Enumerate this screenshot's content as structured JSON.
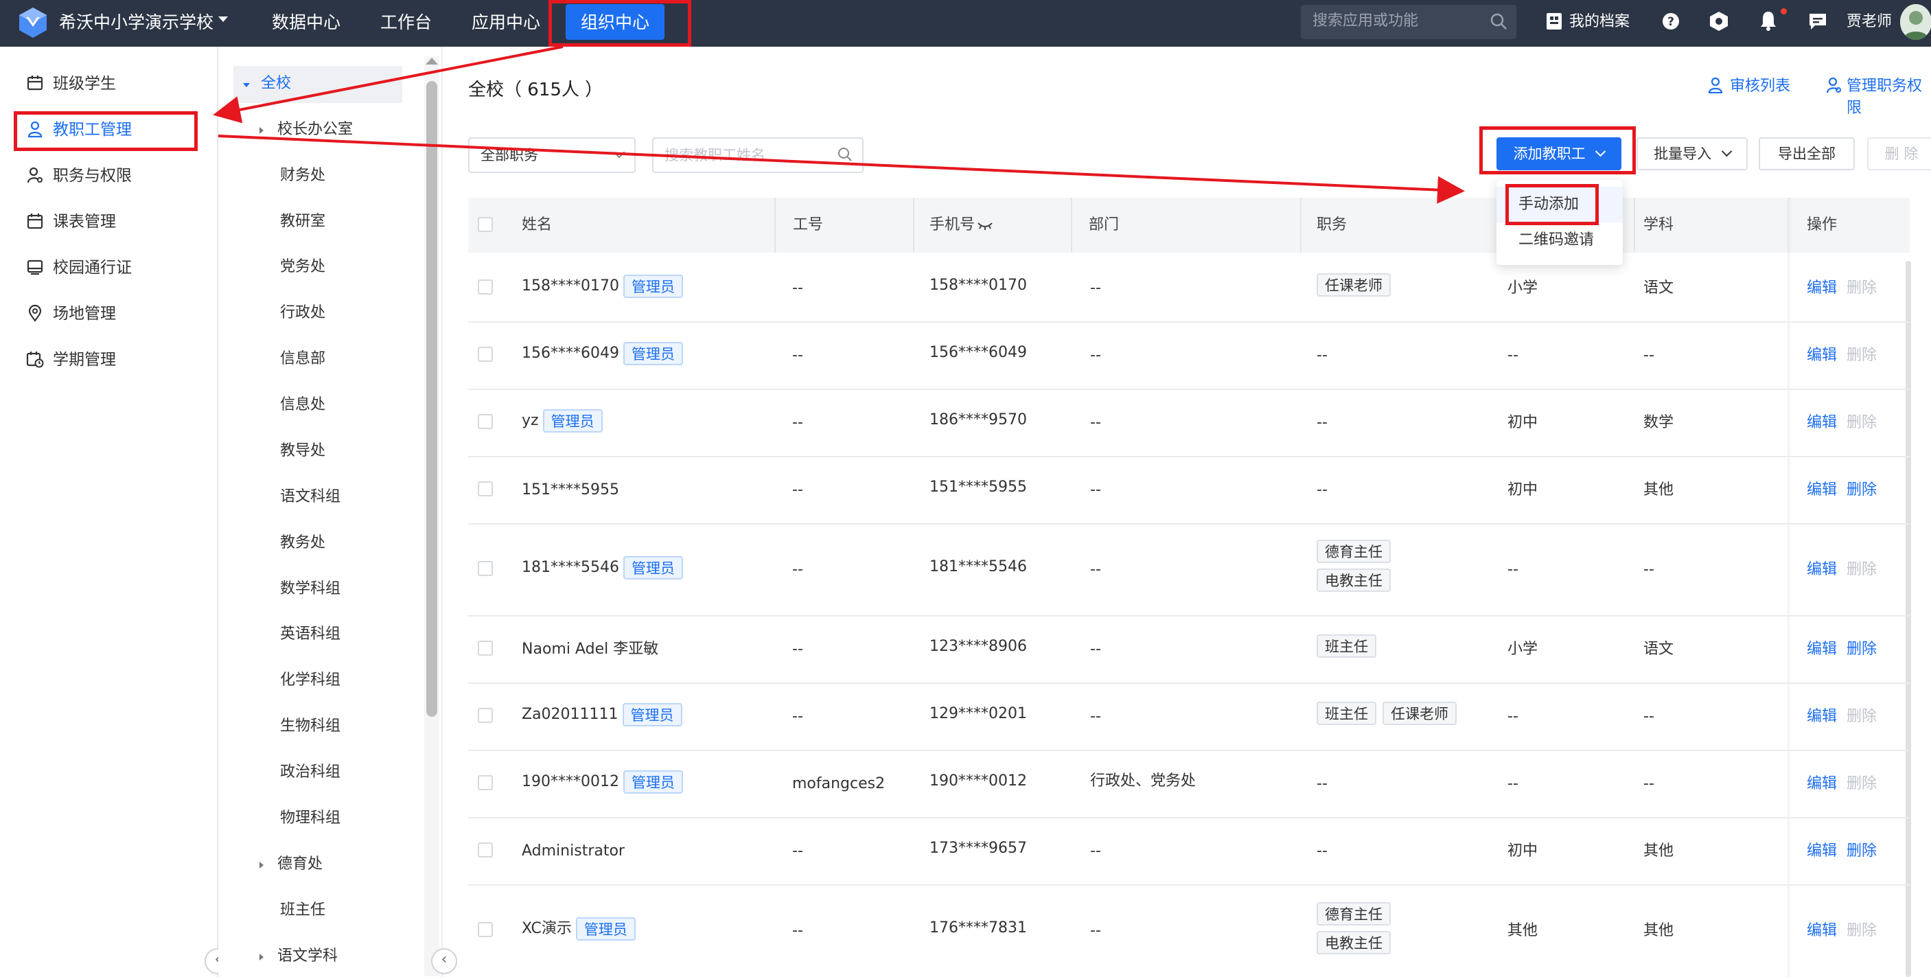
{
  "app": {
    "school_name": "希沃中小学演示学校",
    "nav": [
      "数据中心",
      "工作台",
      "应用中心",
      "组织中心"
    ],
    "search_placeholder": "搜索应用或功能",
    "my_profile": "我的档案",
    "user_name": "贾老师",
    "colors": {
      "topbar": "#2c3545",
      "accent": "#1d6ff2",
      "annotation": "#e5171f"
    }
  },
  "sidebar": {
    "items": [
      {
        "label": "班级学生",
        "icon": "class-icon"
      },
      {
        "label": "教职工管理",
        "icon": "user-icon"
      },
      {
        "label": "职务与权限",
        "icon": "user-key-icon"
      },
      {
        "label": "课表管理",
        "icon": "calendar-icon"
      },
      {
        "label": "校园通行证",
        "icon": "pass-card-icon"
      },
      {
        "label": "场地管理",
        "icon": "location-icon"
      },
      {
        "label": "学期管理",
        "icon": "calendar-clock-icon"
      }
    ]
  },
  "tree": {
    "items": [
      "全校",
      "校长办公室",
      "财务处",
      "教研室",
      "党务处",
      "行政处",
      "信息部",
      "信息处",
      "教导处",
      "语文科组",
      "教务处",
      "数学科组",
      "英语科组",
      "化学科组",
      "生物科组",
      "政治科组",
      "物理科组",
      "德育处",
      "班主任",
      "语文学科"
    ]
  },
  "main": {
    "title": "全校（ 615人 ）",
    "links": {
      "audit": "审核列表",
      "manage_roles": "管理职务权限"
    },
    "filter_select": "全部职务",
    "search_placeholder": "搜索教职工姓名",
    "buttons": {
      "add": "添加教职工",
      "batch_import": "批量导入",
      "export_all": "导出全部",
      "delete": "删 除"
    },
    "dropdown": [
      "手动添加",
      "二维码邀请"
    ],
    "columns": [
      "姓名",
      "工号",
      "手机号",
      "部门",
      "职务",
      "",
      "学科",
      "操作"
    ],
    "admin_tag": "管理员",
    "op_edit": "编辑",
    "op_delete": "删除",
    "rows": [
      {
        "name": "158****0170",
        "id": "--",
        "phone": "158****0170",
        "dept": "--",
        "roles": [
          "任课老师"
        ],
        "stage": "小学",
        "subject": "语文"
      },
      {
        "name": "156****6049",
        "id": "--",
        "phone": "156****6049",
        "dept": "--",
        "roles_text": "--",
        "stage": "--",
        "subject": "--"
      },
      {
        "name": "yz",
        "id": "--",
        "phone": "186****9570",
        "dept": "--",
        "roles_text": "--",
        "stage": "初中",
        "subject": "数学"
      },
      {
        "name": "151****5955",
        "id": "--",
        "phone": "151****5955",
        "dept": "--",
        "roles_text": "--",
        "stage": "初中",
        "subject": "其他"
      },
      {
        "name": "181****5546",
        "id": "--",
        "phone": "181****5546",
        "dept": "--",
        "roles": [
          "德育主任",
          "电教主任"
        ],
        "stage": "--",
        "subject": "--"
      },
      {
        "name": "Naomi Adel 李亚敏",
        "id": "--",
        "phone": "123****8906",
        "dept": "--",
        "roles": [
          "班主任"
        ],
        "stage": "小学",
        "subject": "语文"
      },
      {
        "name": "Za02011111",
        "id": "--",
        "phone": "129****0201",
        "dept": "--",
        "roles": [
          "班主任",
          "任课老师"
        ],
        "stage": "--",
        "subject": "--"
      },
      {
        "name": "190****0012",
        "id": "mofangces2",
        "phone": "190****0012",
        "dept": "行政处、党务处",
        "roles_text": "--",
        "stage": "--",
        "subject": "--"
      },
      {
        "name": "Administrator",
        "id": "--",
        "phone": "173****9657",
        "dept": "--",
        "roles_text": "--",
        "stage": "初中",
        "subject": "其他"
      },
      {
        "name": "XC演示",
        "id": "--",
        "phone": "176****7831",
        "dept": "--",
        "roles": [
          "德育主任",
          "电教主任"
        ],
        "stage": "其他",
        "subject": "其他"
      }
    ]
  }
}
